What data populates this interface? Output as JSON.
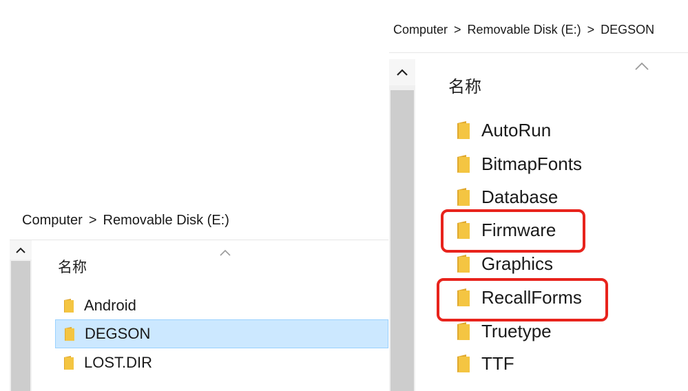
{
  "left_window": {
    "breadcrumb": [
      "Computer",
      "Removable Disk (E:)"
    ],
    "separator": ">",
    "column_header": "名称",
    "items": [
      {
        "label": "Android",
        "selected": false
      },
      {
        "label": "DEGSON",
        "selected": true
      },
      {
        "label": "LOST.DIR",
        "selected": false
      }
    ]
  },
  "right_window": {
    "breadcrumb": [
      "Computer",
      "Removable Disk (E:)",
      "DEGSON"
    ],
    "separator": ">",
    "column_header": "名称",
    "items": [
      {
        "label": "AutoRun",
        "highlighted": false
      },
      {
        "label": "BitmapFonts",
        "highlighted": false
      },
      {
        "label": "Database",
        "highlighted": false
      },
      {
        "label": "Firmware",
        "highlighted": true
      },
      {
        "label": "Graphics",
        "highlighted": false
      },
      {
        "label": "RecallForms",
        "highlighted": true
      },
      {
        "label": "Truetype",
        "highlighted": false
      },
      {
        "label": "TTF",
        "highlighted": false
      }
    ]
  },
  "icons": {
    "folder": "folder-icon",
    "scroll_up": "chevron-up-icon",
    "sort": "sort-ascending-icon"
  },
  "colors": {
    "folder_body": "#f4c542",
    "folder_back": "#e0a82e",
    "selection_bg": "#cce8ff",
    "selection_border": "#99d1ff",
    "highlight": "#e8231c"
  }
}
